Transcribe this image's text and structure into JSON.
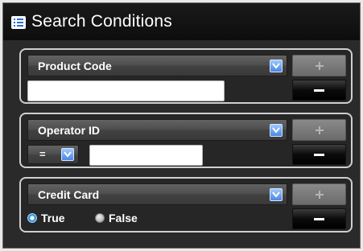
{
  "header": {
    "title": "Search Conditions",
    "icon": "list-icon"
  },
  "conditions": [
    {
      "field": "Product Code",
      "type": "text",
      "value": ""
    },
    {
      "field": "Operator ID",
      "type": "operator-text",
      "operator": "=",
      "value": ""
    },
    {
      "field": "Credit Card",
      "type": "boolean",
      "options": [
        "True",
        "False"
      ],
      "selected": "True"
    }
  ],
  "colors": {
    "accent": "#4b86e6",
    "panel_bg": "#2a2a2a",
    "border": "#cfcfcf"
  }
}
